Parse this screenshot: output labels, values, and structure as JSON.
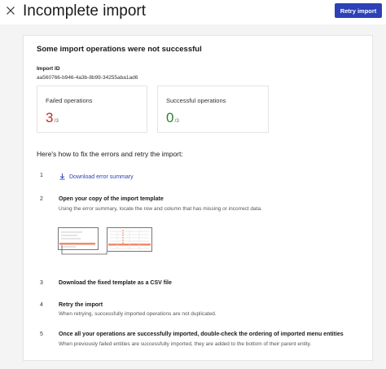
{
  "header": {
    "title": "Incomplete import",
    "retry_label": "Retry import"
  },
  "card": {
    "title": "Some import operations were not successful",
    "import_id_label": "Import ID",
    "import_id_value": "aa560766-b946-4a3b-8b99-34255aba1ad6"
  },
  "stats": {
    "failed": {
      "label": "Failed operations",
      "value": "3",
      "total": "/3"
    },
    "success": {
      "label": "Successful operations",
      "value": "0",
      "total": "/3"
    }
  },
  "instructions": {
    "heading": "Here's how to fix the errors and retry the import:",
    "steps": [
      {
        "num": "1",
        "link_label": "Download error summary"
      },
      {
        "num": "2",
        "title": "Open your copy of the import template",
        "desc": "Using the error summary, locate the row and column that has missing or incorrect data."
      },
      {
        "num": "3",
        "title": "Download the fixed template as a CSV file"
      },
      {
        "num": "4",
        "title": "Retry the import",
        "desc": "When retrying, successfully imported operations are not duplicated."
      },
      {
        "num": "5",
        "title": "Once all your operations are successfully imported, double-check the ordering of imported menu entities",
        "desc": "When previously failed entities are successfully imported, they are added to the bottom of their parent entity."
      }
    ]
  },
  "colors": {
    "primary": "#2c41b8",
    "failed": "#c62828",
    "success": "#2e7d32",
    "highlight": "#f08a6a"
  },
  "icons": {
    "close": "close-icon",
    "download": "download-icon"
  }
}
